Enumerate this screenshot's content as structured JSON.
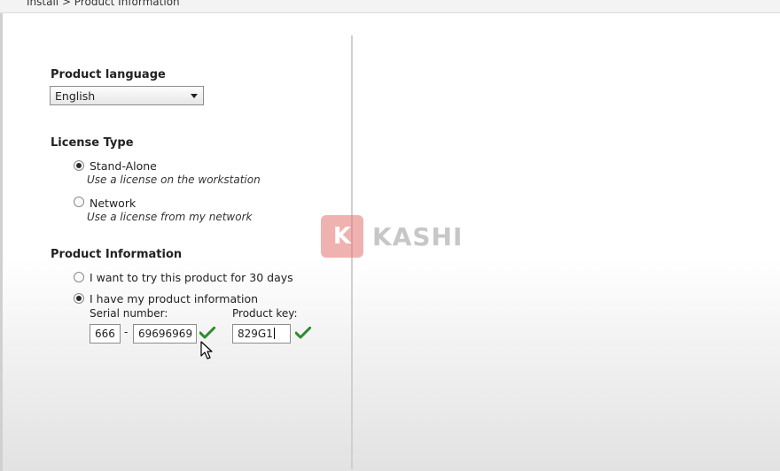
{
  "breadcrumb": "Install > Product Information",
  "product_language": {
    "title": "Product language",
    "selected": "English"
  },
  "license_type": {
    "title": "License Type",
    "options": [
      {
        "label": "Stand-Alone",
        "description": "Use a license on the workstation",
        "selected": true
      },
      {
        "label": "Network",
        "description": "Use a license from my network",
        "selected": false
      }
    ]
  },
  "product_information": {
    "title": "Product Information",
    "options": [
      {
        "label": "I want to try this product for 30 days",
        "selected": false
      },
      {
        "label": "I have my product information",
        "selected": true
      }
    ],
    "serial_number": {
      "label": "Serial number:",
      "prefix": "666",
      "separator": "-",
      "value": "69696969",
      "valid": true
    },
    "product_key": {
      "label": "Product key:",
      "value": "829G1",
      "valid": true
    }
  },
  "watermark": {
    "letter": "K",
    "text": "KASHI",
    "color": "#e57373"
  },
  "colors": {
    "valid_check": "#2e8b2e"
  },
  "icons": {
    "valid": "checkmark-icon",
    "pointer": "mouse-pointer-icon",
    "dropdown": "chevron-down-icon"
  }
}
